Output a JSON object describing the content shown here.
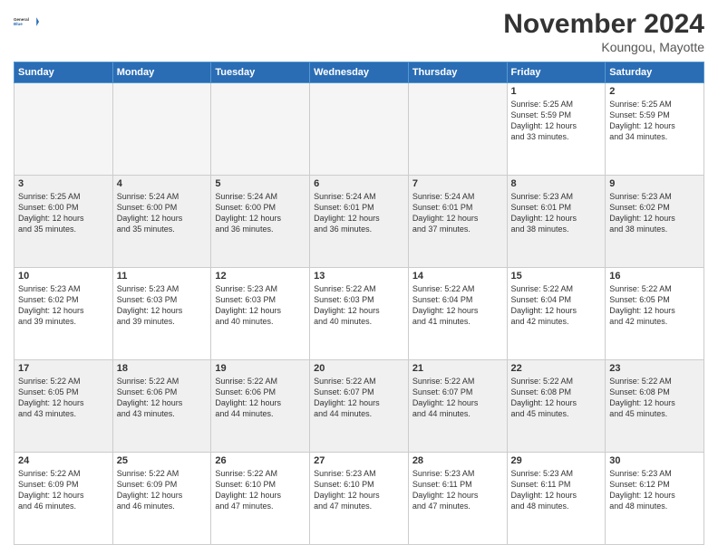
{
  "logo": {
    "line1": "General",
    "line2": "Blue"
  },
  "title": "November 2024",
  "location": "Koungou, Mayotte",
  "days_of_week": [
    "Sunday",
    "Monday",
    "Tuesday",
    "Wednesday",
    "Thursday",
    "Friday",
    "Saturday"
  ],
  "weeks": [
    [
      {
        "day": "",
        "info": "",
        "empty": true
      },
      {
        "day": "",
        "info": "",
        "empty": true
      },
      {
        "day": "",
        "info": "",
        "empty": true
      },
      {
        "day": "",
        "info": "",
        "empty": true
      },
      {
        "day": "",
        "info": "",
        "empty": true
      },
      {
        "day": "1",
        "info": "Sunrise: 5:25 AM\nSunset: 5:59 PM\nDaylight: 12 hours\nand 33 minutes."
      },
      {
        "day": "2",
        "info": "Sunrise: 5:25 AM\nSunset: 5:59 PM\nDaylight: 12 hours\nand 34 minutes."
      }
    ],
    [
      {
        "day": "3",
        "info": "Sunrise: 5:25 AM\nSunset: 6:00 PM\nDaylight: 12 hours\nand 35 minutes."
      },
      {
        "day": "4",
        "info": "Sunrise: 5:24 AM\nSunset: 6:00 PM\nDaylight: 12 hours\nand 35 minutes."
      },
      {
        "day": "5",
        "info": "Sunrise: 5:24 AM\nSunset: 6:00 PM\nDaylight: 12 hours\nand 36 minutes."
      },
      {
        "day": "6",
        "info": "Sunrise: 5:24 AM\nSunset: 6:01 PM\nDaylight: 12 hours\nand 36 minutes."
      },
      {
        "day": "7",
        "info": "Sunrise: 5:24 AM\nSunset: 6:01 PM\nDaylight: 12 hours\nand 37 minutes."
      },
      {
        "day": "8",
        "info": "Sunrise: 5:23 AM\nSunset: 6:01 PM\nDaylight: 12 hours\nand 38 minutes."
      },
      {
        "day": "9",
        "info": "Sunrise: 5:23 AM\nSunset: 6:02 PM\nDaylight: 12 hours\nand 38 minutes."
      }
    ],
    [
      {
        "day": "10",
        "info": "Sunrise: 5:23 AM\nSunset: 6:02 PM\nDaylight: 12 hours\nand 39 minutes."
      },
      {
        "day": "11",
        "info": "Sunrise: 5:23 AM\nSunset: 6:03 PM\nDaylight: 12 hours\nand 39 minutes."
      },
      {
        "day": "12",
        "info": "Sunrise: 5:23 AM\nSunset: 6:03 PM\nDaylight: 12 hours\nand 40 minutes."
      },
      {
        "day": "13",
        "info": "Sunrise: 5:22 AM\nSunset: 6:03 PM\nDaylight: 12 hours\nand 40 minutes."
      },
      {
        "day": "14",
        "info": "Sunrise: 5:22 AM\nSunset: 6:04 PM\nDaylight: 12 hours\nand 41 minutes."
      },
      {
        "day": "15",
        "info": "Sunrise: 5:22 AM\nSunset: 6:04 PM\nDaylight: 12 hours\nand 42 minutes."
      },
      {
        "day": "16",
        "info": "Sunrise: 5:22 AM\nSunset: 6:05 PM\nDaylight: 12 hours\nand 42 minutes."
      }
    ],
    [
      {
        "day": "17",
        "info": "Sunrise: 5:22 AM\nSunset: 6:05 PM\nDaylight: 12 hours\nand 43 minutes."
      },
      {
        "day": "18",
        "info": "Sunrise: 5:22 AM\nSunset: 6:06 PM\nDaylight: 12 hours\nand 43 minutes."
      },
      {
        "day": "19",
        "info": "Sunrise: 5:22 AM\nSunset: 6:06 PM\nDaylight: 12 hours\nand 44 minutes."
      },
      {
        "day": "20",
        "info": "Sunrise: 5:22 AM\nSunset: 6:07 PM\nDaylight: 12 hours\nand 44 minutes."
      },
      {
        "day": "21",
        "info": "Sunrise: 5:22 AM\nSunset: 6:07 PM\nDaylight: 12 hours\nand 44 minutes."
      },
      {
        "day": "22",
        "info": "Sunrise: 5:22 AM\nSunset: 6:08 PM\nDaylight: 12 hours\nand 45 minutes."
      },
      {
        "day": "23",
        "info": "Sunrise: 5:22 AM\nSunset: 6:08 PM\nDaylight: 12 hours\nand 45 minutes."
      }
    ],
    [
      {
        "day": "24",
        "info": "Sunrise: 5:22 AM\nSunset: 6:09 PM\nDaylight: 12 hours\nand 46 minutes."
      },
      {
        "day": "25",
        "info": "Sunrise: 5:22 AM\nSunset: 6:09 PM\nDaylight: 12 hours\nand 46 minutes."
      },
      {
        "day": "26",
        "info": "Sunrise: 5:22 AM\nSunset: 6:10 PM\nDaylight: 12 hours\nand 47 minutes."
      },
      {
        "day": "27",
        "info": "Sunrise: 5:23 AM\nSunset: 6:10 PM\nDaylight: 12 hours\nand 47 minutes."
      },
      {
        "day": "28",
        "info": "Sunrise: 5:23 AM\nSunset: 6:11 PM\nDaylight: 12 hours\nand 47 minutes."
      },
      {
        "day": "29",
        "info": "Sunrise: 5:23 AM\nSunset: 6:11 PM\nDaylight: 12 hours\nand 48 minutes."
      },
      {
        "day": "30",
        "info": "Sunrise: 5:23 AM\nSunset: 6:12 PM\nDaylight: 12 hours\nand 48 minutes."
      }
    ]
  ]
}
